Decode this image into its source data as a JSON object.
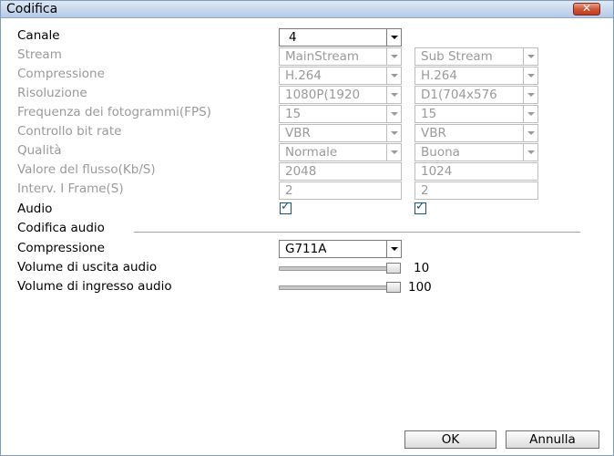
{
  "window": {
    "title": "Codifica",
    "close_glyph": "✕"
  },
  "rows": [
    {
      "label": "Canale",
      "enabled": true
    },
    {
      "label": "Stream",
      "enabled": false
    },
    {
      "label": "Compressione",
      "enabled": false
    },
    {
      "label": "Risoluzione",
      "enabled": false
    },
    {
      "label": "Frequenza dei fotogrammi(FPS)",
      "enabled": false
    },
    {
      "label": "Controllo bit rate",
      "enabled": false
    },
    {
      "label": "Qualità",
      "enabled": false
    },
    {
      "label": "Valore del flusso(Kb/S)",
      "enabled": false
    },
    {
      "label": "Interv. I Frame(S)",
      "enabled": false
    },
    {
      "label": "Audio",
      "enabled": true
    }
  ],
  "channel": "4",
  "main_stream": {
    "stream": "MainStream",
    "compression": "H.264",
    "resolution": "1080P(1920",
    "fps": "15",
    "bitrate_control": "VBR",
    "quality": "Normale",
    "bitrate_value": "2048",
    "iframe_interval": "2",
    "audio_checked": true
  },
  "sub_stream": {
    "stream": "Sub Stream",
    "compression": "H.264",
    "resolution": "D1(704x576",
    "fps": "15",
    "bitrate_control": "VBR",
    "quality": "Buona",
    "bitrate_value": "1024",
    "iframe_interval": "2",
    "audio_checked": true
  },
  "audio_section": {
    "title": "Codifica audio",
    "compression_label": "Compressione",
    "compression_value": "G711A",
    "output_volume_label": "Volume di uscita audio",
    "output_volume": 10,
    "output_volume_text": "10",
    "input_volume_label": "Volume di ingresso audio",
    "input_volume": 100,
    "input_volume_text": "100"
  },
  "buttons": {
    "ok": "OK",
    "cancel": "Annulla"
  },
  "icons": {
    "check": "✓"
  }
}
